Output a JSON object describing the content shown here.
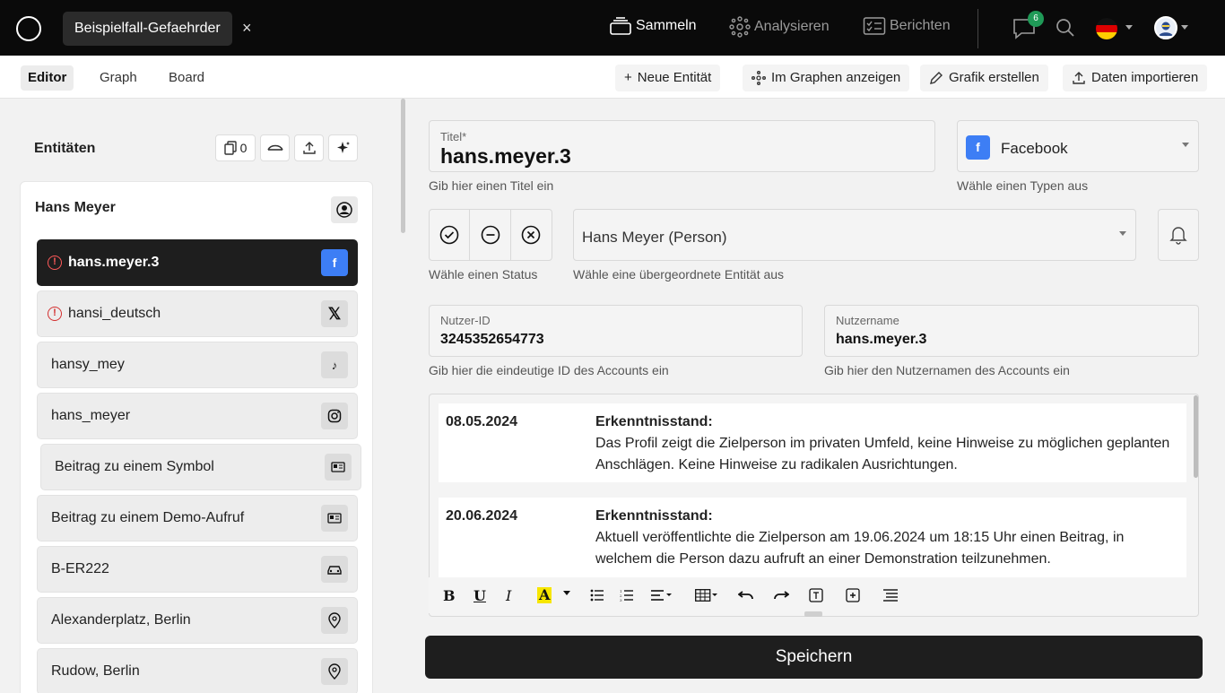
{
  "topbar": {
    "case_tab": "Beispielfall-Gefaehrder",
    "close_glyph": "×",
    "nav": {
      "sammeln": "Sammeln",
      "analysieren": "Analysieren",
      "berichten": "Berichten"
    },
    "notifications": "6"
  },
  "toolbar": {
    "tabs": [
      "Editor",
      "Graph",
      "Board"
    ],
    "new_entity": "Neue Entität",
    "show_in_graph": "Im Graphen anzeigen",
    "create_graphic": "Grafik erstellen",
    "import_data": "Daten importieren"
  },
  "left": {
    "title": "Entitäten",
    "copy_count": "0",
    "person": "Hans Meyer",
    "items": [
      {
        "label": "hans.meyer.3",
        "icon": "facebook-icon",
        "warning": true
      },
      {
        "label": "hansi_deutsch",
        "icon": "x-icon",
        "warning": true
      },
      {
        "label": "hansy_mey",
        "icon": "tiktok-icon",
        "warning": false
      },
      {
        "label": "hans_meyer",
        "icon": "instagram-icon",
        "warning": false
      },
      {
        "label": "Beitrag zu einem Symbol",
        "icon": "post-icon",
        "warning": false
      },
      {
        "label": "Beitrag zu einem Demo-Aufruf",
        "icon": "post-icon",
        "warning": false
      },
      {
        "label": "B-ER222",
        "icon": "car-icon",
        "warning": false
      },
      {
        "label": "Alexanderplatz, Berlin",
        "icon": "location-icon",
        "warning": false
      },
      {
        "label": "Rudow, Berlin",
        "icon": "location-icon",
        "warning": false
      }
    ]
  },
  "form": {
    "title_label": "Titel*",
    "title_value": "hans.meyer.3",
    "title_hint": "Gib hier einen Titel ein",
    "type_value": "Facebook",
    "type_hint": "Wähle einen Typen aus",
    "status_hint": "Wähle einen Status",
    "parent_value": "Hans Meyer (Person)",
    "parent_hint": "Wähle eine übergeordnete Entität aus",
    "user_id_label": "Nutzer-ID",
    "user_id_value": "3245352654773",
    "user_id_hint": "Gib hier die eindeutige ID des Accounts ein",
    "username_label": "Nutzername",
    "username_value": "hans.meyer.3",
    "username_hint": "Gib hier den Nutzernamen des Accounts ein"
  },
  "notes": [
    {
      "date": "08.05.2024",
      "heading": "Erkenntnisstand:",
      "text": "Das Profil zeigt die Zielperson im privaten Umfeld, keine Hinweise zu möglichen geplanten Anschlägen. Keine Hinweise zu radikalen Ausrichtungen."
    },
    {
      "date": "20.06.2024",
      "heading": "Erkenntnisstand:",
      "text": "Aktuell veröffentlichte die Zielperson am 19.06.2024 um 18:15 Uhr einen Beitrag, in welchem die Person dazu aufruft an einer Demonstration teilzunehmen."
    }
  ],
  "editor": {
    "bold": "B",
    "underline": "U",
    "italic": "I",
    "highlight": "A"
  },
  "save": "Speichern",
  "colors": {
    "accent_blue": "#3d7ef5",
    "warning_red": "#d32f2f",
    "badge_green": "#1f9a57",
    "dark": "#1e1e1e"
  }
}
